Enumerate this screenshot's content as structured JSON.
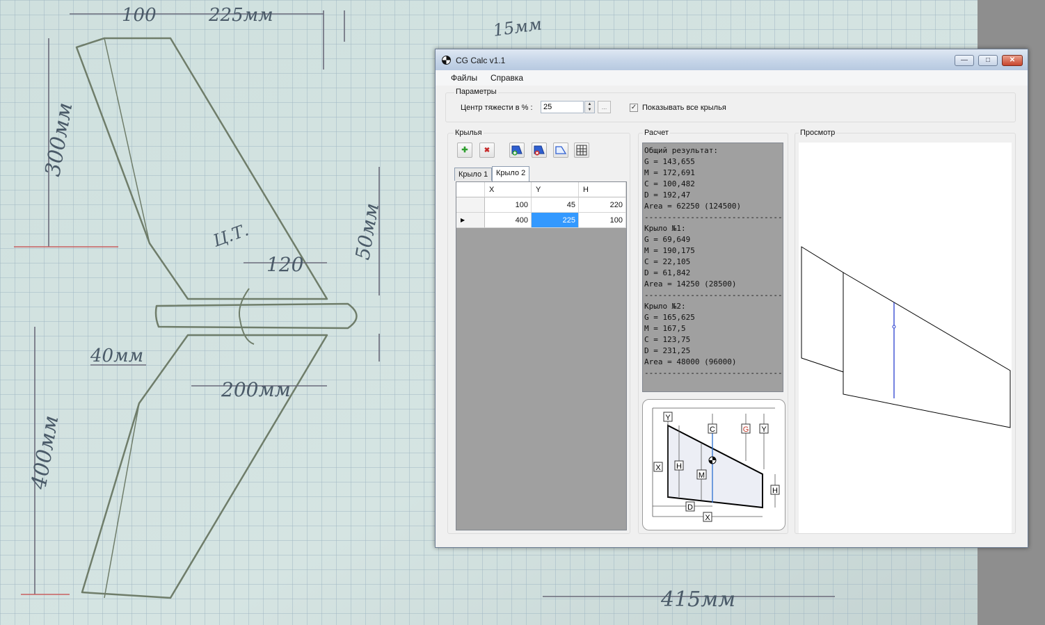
{
  "background_sketch": {
    "dimensions": [
      "100",
      "225мм",
      "15мм",
      "300мм",
      "Ц.Т.",
      "120",
      "50мм",
      "40мм",
      "200мм",
      "400мм",
      "415мм"
    ]
  },
  "window": {
    "title": "CG Calc v1.1",
    "icon": "cg-balance-icon",
    "controls": {
      "minimize": "—",
      "maximize": "□",
      "close": "✕"
    }
  },
  "menu": [
    "Файлы",
    "Справка"
  ],
  "parameters": {
    "group_label": "Параметры",
    "cg_label": "Центр тяжести в %  :",
    "cg_value": "25",
    "more_button": "...",
    "show_all_wings_label": "Показывать все крылья",
    "show_all_wings_checked": true
  },
  "wings": {
    "group_label": "Крылья",
    "toolbar": [
      {
        "icon": "add-icon",
        "glyph": "✚",
        "color": "#2e9e2e"
      },
      {
        "icon": "delete-icon",
        "glyph": "✖",
        "color": "#c62828"
      },
      {
        "icon": "add-wing-icon",
        "glyph": "▰",
        "color": "#2f5fd0"
      },
      {
        "icon": "remove-wing-icon",
        "glyph": "▰",
        "color": "#2f5fd0"
      },
      {
        "icon": "wing-shape-icon",
        "glyph": "⏢",
        "color": "#2f5fd0"
      },
      {
        "icon": "settings-grid-icon",
        "glyph": "⚙",
        "color": "#333333"
      }
    ],
    "tabs": [
      "Крыло 1",
      "Крыло 2"
    ],
    "active_tab": 1,
    "columns": [
      "X",
      "Y",
      "H"
    ],
    "rows": [
      {
        "X": "100",
        "Y": "45",
        "H": "220"
      },
      {
        "X": "400",
        "Y": "225",
        "H": "100"
      }
    ],
    "current_row_marker": "▶",
    "selected_cell": {
      "row": 1,
      "column": "Y"
    }
  },
  "calculation": {
    "group_label": "Расчет",
    "output_lines": [
      "Общий результат:",
      "G = 143,655",
      "M = 172,691",
      "C = 100,482",
      "D = 192,47",
      "Area = 62250 (124500)",
      "------------------------------",
      "Крыло №1:",
      "G = 69,649",
      "M = 190,175",
      "C = 22,105",
      "D = 61,842",
      "Area = 14250 (28500)",
      "------------------------------",
      "Крыло №2:",
      "G = 165,625",
      "M = 167,5",
      "C = 123,75",
      "D = 231,25",
      "Area = 48000 (96000)",
      "------------------------------"
    ],
    "diagram_labels": {
      "y_top": "Y",
      "c": "C",
      "g": "G",
      "y_right": "Y",
      "x_left": "X",
      "h_left": "H",
      "m": "M",
      "h_right": "H",
      "d": "D",
      "x_bottom": "X"
    },
    "colors": {
      "g_label": "#c0392b",
      "m_line": "#2a6fd0",
      "wing_fill": "#eceef5"
    }
  },
  "preview": {
    "group_label": "Просмотр",
    "colors": {
      "outline": "#000000",
      "cg_line": "#2a3fd0"
    }
  }
}
